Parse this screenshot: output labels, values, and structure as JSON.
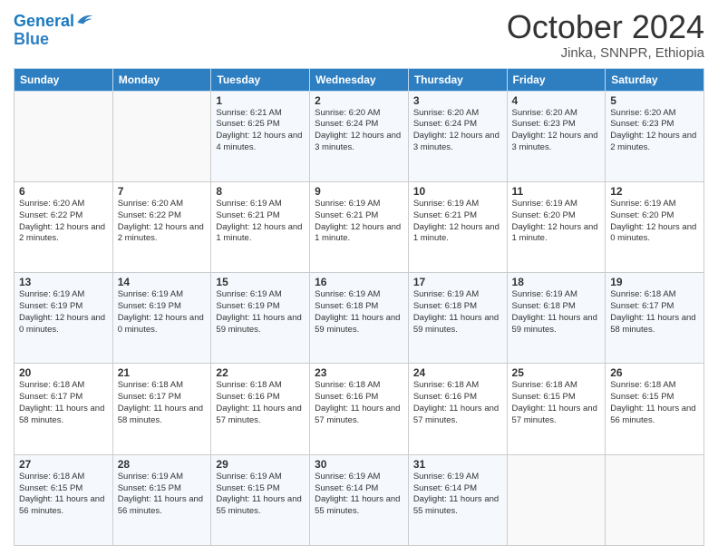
{
  "logo": {
    "line1": "General",
    "line2": "Blue"
  },
  "header": {
    "month": "October 2024",
    "location": "Jinka, SNNPR, Ethiopia"
  },
  "weekdays": [
    "Sunday",
    "Monday",
    "Tuesday",
    "Wednesday",
    "Thursday",
    "Friday",
    "Saturday"
  ],
  "weeks": [
    [
      {
        "day": "",
        "info": ""
      },
      {
        "day": "",
        "info": ""
      },
      {
        "day": "1",
        "info": "Sunrise: 6:21 AM\nSunset: 6:25 PM\nDaylight: 12 hours and 4 minutes."
      },
      {
        "day": "2",
        "info": "Sunrise: 6:20 AM\nSunset: 6:24 PM\nDaylight: 12 hours and 3 minutes."
      },
      {
        "day": "3",
        "info": "Sunrise: 6:20 AM\nSunset: 6:24 PM\nDaylight: 12 hours and 3 minutes."
      },
      {
        "day": "4",
        "info": "Sunrise: 6:20 AM\nSunset: 6:23 PM\nDaylight: 12 hours and 3 minutes."
      },
      {
        "day": "5",
        "info": "Sunrise: 6:20 AM\nSunset: 6:23 PM\nDaylight: 12 hours and 2 minutes."
      }
    ],
    [
      {
        "day": "6",
        "info": "Sunrise: 6:20 AM\nSunset: 6:22 PM\nDaylight: 12 hours and 2 minutes."
      },
      {
        "day": "7",
        "info": "Sunrise: 6:20 AM\nSunset: 6:22 PM\nDaylight: 12 hours and 2 minutes."
      },
      {
        "day": "8",
        "info": "Sunrise: 6:19 AM\nSunset: 6:21 PM\nDaylight: 12 hours and 1 minute."
      },
      {
        "day": "9",
        "info": "Sunrise: 6:19 AM\nSunset: 6:21 PM\nDaylight: 12 hours and 1 minute."
      },
      {
        "day": "10",
        "info": "Sunrise: 6:19 AM\nSunset: 6:21 PM\nDaylight: 12 hours and 1 minute."
      },
      {
        "day": "11",
        "info": "Sunrise: 6:19 AM\nSunset: 6:20 PM\nDaylight: 12 hours and 1 minute."
      },
      {
        "day": "12",
        "info": "Sunrise: 6:19 AM\nSunset: 6:20 PM\nDaylight: 12 hours and 0 minutes."
      }
    ],
    [
      {
        "day": "13",
        "info": "Sunrise: 6:19 AM\nSunset: 6:19 PM\nDaylight: 12 hours and 0 minutes."
      },
      {
        "day": "14",
        "info": "Sunrise: 6:19 AM\nSunset: 6:19 PM\nDaylight: 12 hours and 0 minutes."
      },
      {
        "day": "15",
        "info": "Sunrise: 6:19 AM\nSunset: 6:19 PM\nDaylight: 11 hours and 59 minutes."
      },
      {
        "day": "16",
        "info": "Sunrise: 6:19 AM\nSunset: 6:18 PM\nDaylight: 11 hours and 59 minutes."
      },
      {
        "day": "17",
        "info": "Sunrise: 6:19 AM\nSunset: 6:18 PM\nDaylight: 11 hours and 59 minutes."
      },
      {
        "day": "18",
        "info": "Sunrise: 6:19 AM\nSunset: 6:18 PM\nDaylight: 11 hours and 59 minutes."
      },
      {
        "day": "19",
        "info": "Sunrise: 6:18 AM\nSunset: 6:17 PM\nDaylight: 11 hours and 58 minutes."
      }
    ],
    [
      {
        "day": "20",
        "info": "Sunrise: 6:18 AM\nSunset: 6:17 PM\nDaylight: 11 hours and 58 minutes."
      },
      {
        "day": "21",
        "info": "Sunrise: 6:18 AM\nSunset: 6:17 PM\nDaylight: 11 hours and 58 minutes."
      },
      {
        "day": "22",
        "info": "Sunrise: 6:18 AM\nSunset: 6:16 PM\nDaylight: 11 hours and 57 minutes."
      },
      {
        "day": "23",
        "info": "Sunrise: 6:18 AM\nSunset: 6:16 PM\nDaylight: 11 hours and 57 minutes."
      },
      {
        "day": "24",
        "info": "Sunrise: 6:18 AM\nSunset: 6:16 PM\nDaylight: 11 hours and 57 minutes."
      },
      {
        "day": "25",
        "info": "Sunrise: 6:18 AM\nSunset: 6:15 PM\nDaylight: 11 hours and 57 minutes."
      },
      {
        "day": "26",
        "info": "Sunrise: 6:18 AM\nSunset: 6:15 PM\nDaylight: 11 hours and 56 minutes."
      }
    ],
    [
      {
        "day": "27",
        "info": "Sunrise: 6:18 AM\nSunset: 6:15 PM\nDaylight: 11 hours and 56 minutes."
      },
      {
        "day": "28",
        "info": "Sunrise: 6:19 AM\nSunset: 6:15 PM\nDaylight: 11 hours and 56 minutes."
      },
      {
        "day": "29",
        "info": "Sunrise: 6:19 AM\nSunset: 6:15 PM\nDaylight: 11 hours and 55 minutes."
      },
      {
        "day": "30",
        "info": "Sunrise: 6:19 AM\nSunset: 6:14 PM\nDaylight: 11 hours and 55 minutes."
      },
      {
        "day": "31",
        "info": "Sunrise: 6:19 AM\nSunset: 6:14 PM\nDaylight: 11 hours and 55 minutes."
      },
      {
        "day": "",
        "info": ""
      },
      {
        "day": "",
        "info": ""
      }
    ]
  ]
}
